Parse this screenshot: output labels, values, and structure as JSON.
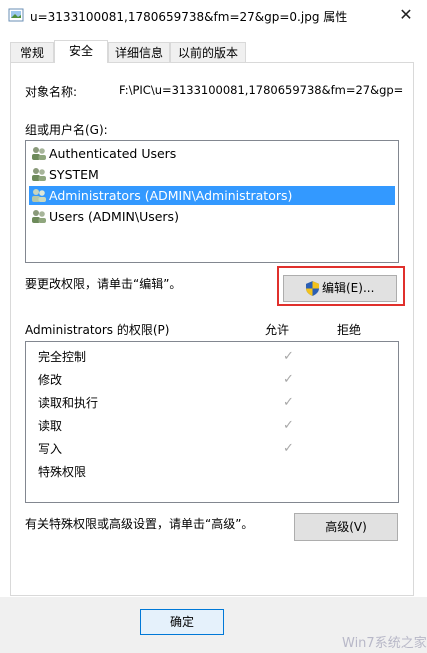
{
  "window": {
    "title": "u=3133100081,1780659738&fm=27&gp=0.jpg 属性",
    "close_glyph": "✕"
  },
  "tabs": [
    {
      "label": "常规"
    },
    {
      "label": "安全",
      "active": true
    },
    {
      "label": "详细信息"
    },
    {
      "label": "以前的版本"
    }
  ],
  "security": {
    "object_name_label": "对象名称:",
    "object_name_value": "F:\\PIC\\u=3133100081,1780659738&fm=27&gp=",
    "groups_label": "组或用户名(G):",
    "users": [
      {
        "name": "Authenticated Users",
        "icon": "users-group-icon"
      },
      {
        "name": "SYSTEM",
        "icon": "users-group-icon"
      },
      {
        "name": "Administrators (ADMIN\\Administrators)",
        "icon": "users-group-icon",
        "selected": true
      },
      {
        "name": "Users (ADMIN\\Users)",
        "icon": "users-group-icon"
      }
    ],
    "edit_hint": "要更改权限，请单击“编辑”。",
    "edit_button": "编辑(E)...",
    "permissions_label": "Administrators 的权限(P)",
    "allow_header": "允许",
    "deny_header": "拒绝",
    "permissions": [
      {
        "name": "完全控制",
        "allow": true
      },
      {
        "name": "修改",
        "allow": true
      },
      {
        "name": "读取和执行",
        "allow": true
      },
      {
        "name": "读取",
        "allow": true
      },
      {
        "name": "写入",
        "allow": true
      },
      {
        "name": "特殊权限",
        "allow": false
      }
    ],
    "check_glyph": "✓",
    "advanced_hint": "有关特殊权限或高级设置，请单击“高级”。",
    "advanced_button": "高级(V)"
  },
  "footer": {
    "ok_button": "确定"
  },
  "watermark": "Win7系统之家",
  "colors": {
    "selection": "#3399ff",
    "highlight_frame": "#e0302c",
    "button_face": "#e1e1e1",
    "check": "#a8a8a8"
  }
}
